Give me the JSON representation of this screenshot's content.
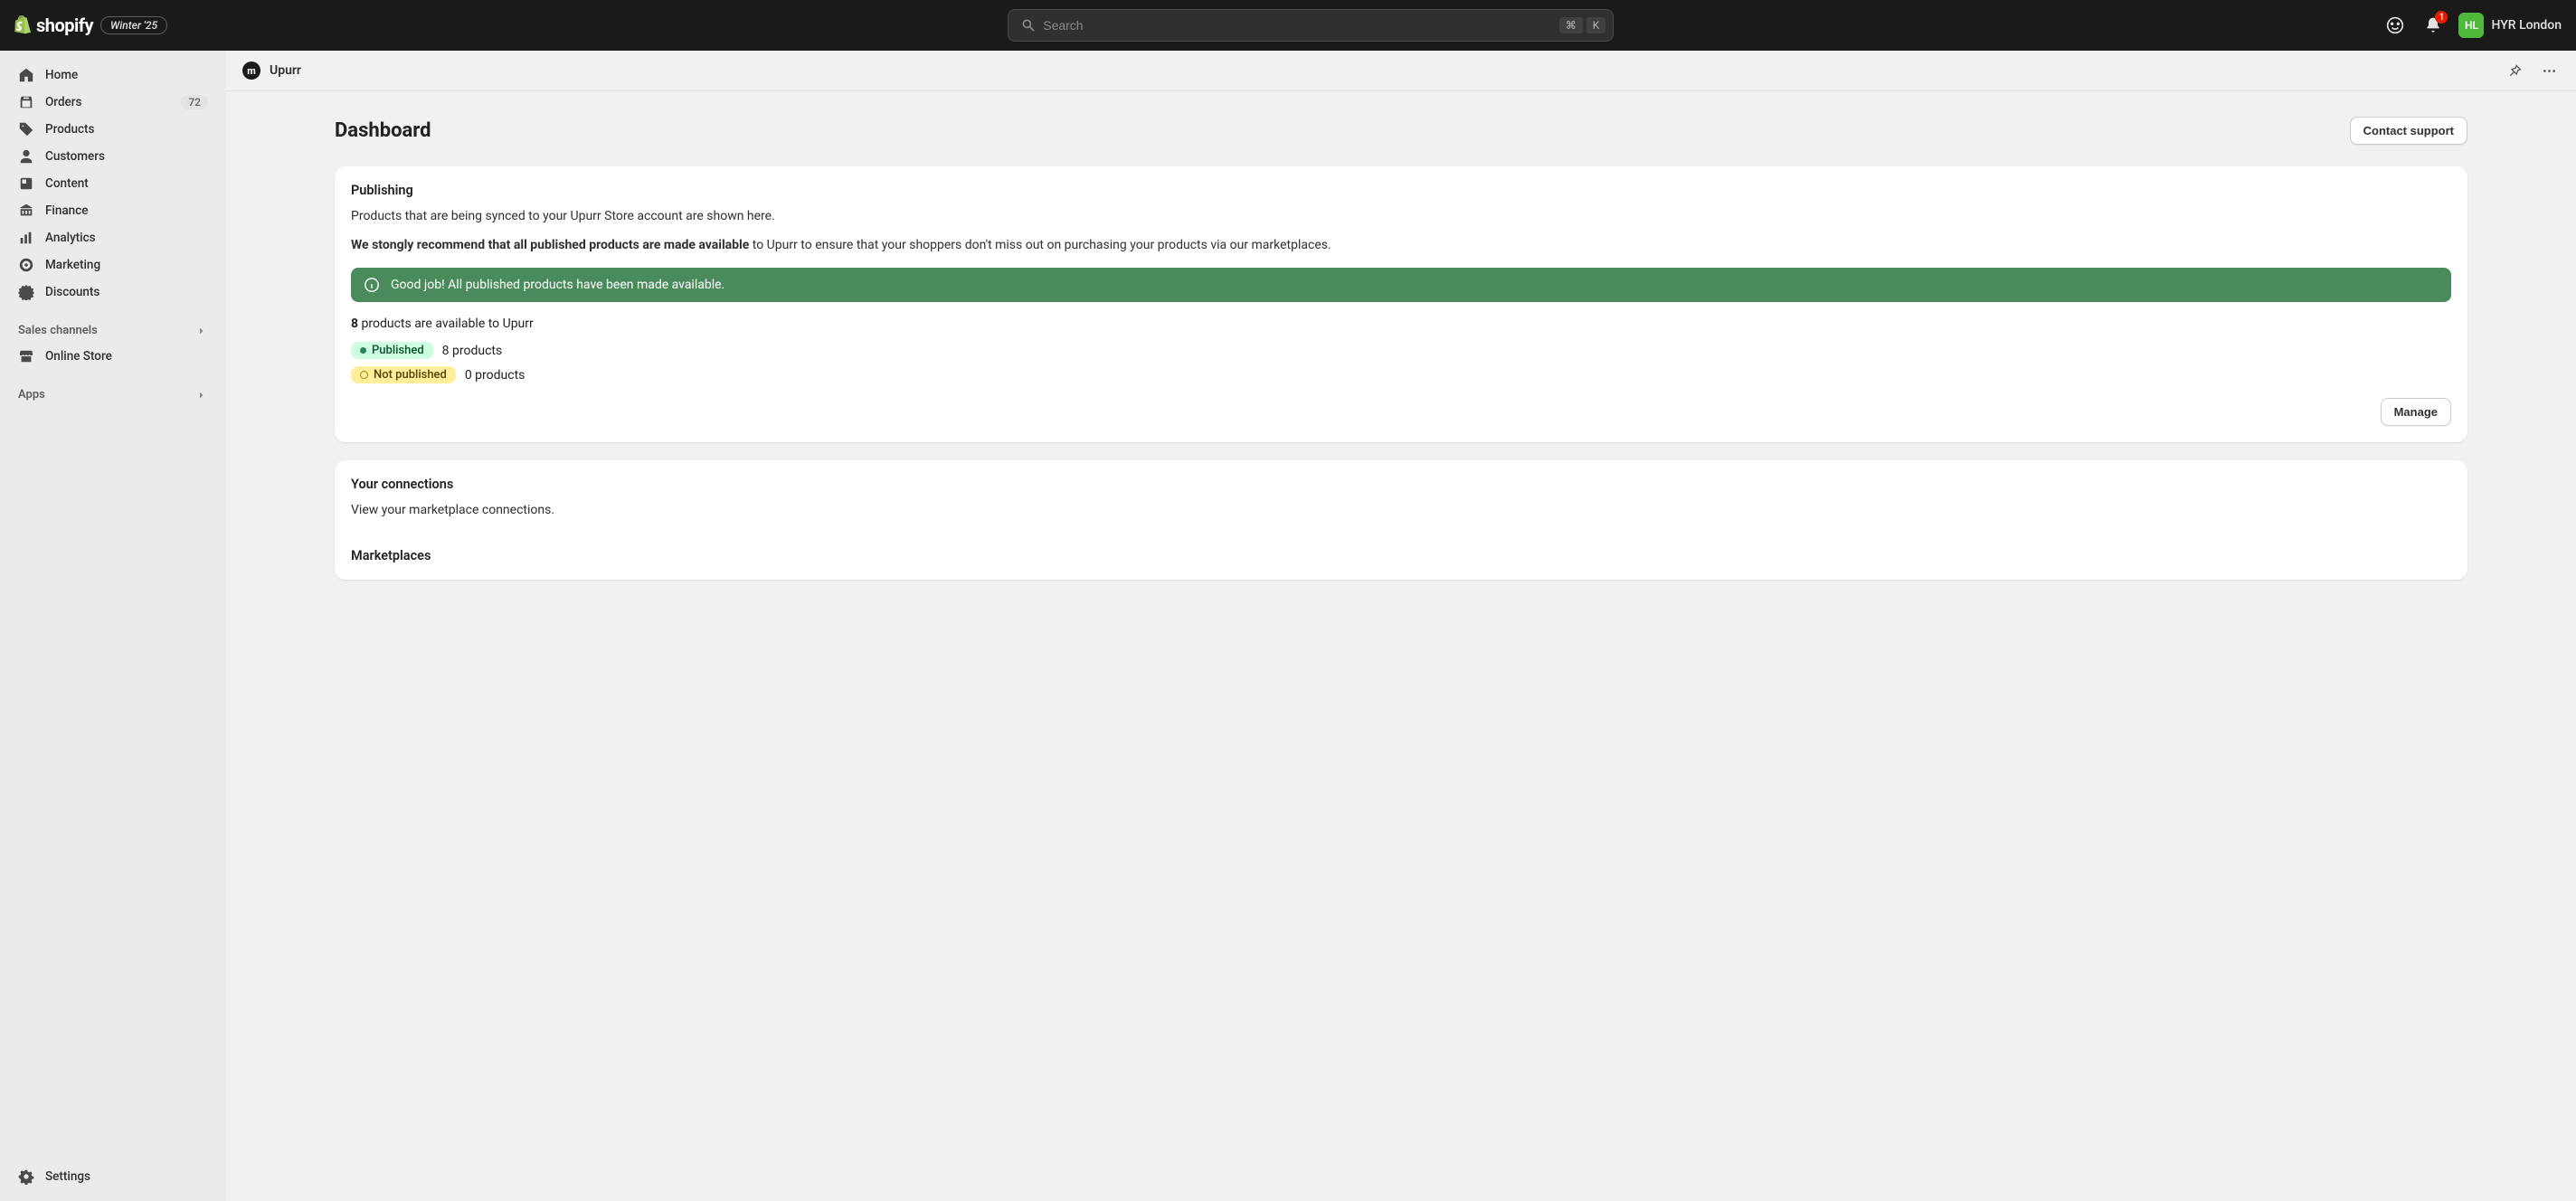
{
  "header": {
    "brand": "shopify",
    "edition_badge": "Winter '25",
    "search_placeholder": "Search",
    "shortcut_keys": [
      "⌘",
      "K"
    ],
    "notification_count": "1",
    "avatar_initials": "HL",
    "user_name": "HYR London"
  },
  "sidebar": {
    "items": [
      {
        "label": "Home",
        "icon": "home"
      },
      {
        "label": "Orders",
        "icon": "orders",
        "badge": "72"
      },
      {
        "label": "Products",
        "icon": "products"
      },
      {
        "label": "Customers",
        "icon": "customers"
      },
      {
        "label": "Content",
        "icon": "content"
      },
      {
        "label": "Finance",
        "icon": "finance"
      },
      {
        "label": "Analytics",
        "icon": "analytics"
      },
      {
        "label": "Marketing",
        "icon": "marketing"
      },
      {
        "label": "Discounts",
        "icon": "discounts"
      }
    ],
    "section_sales": "Sales channels",
    "online_store": "Online Store",
    "section_apps": "Apps",
    "settings": "Settings"
  },
  "app_bar": {
    "app_icon_letter": "m",
    "title": "Upurr"
  },
  "page": {
    "title": "Dashboard",
    "contact_btn": "Contact support"
  },
  "publishing": {
    "title": "Publishing",
    "description": "Products that are being synced to your Upurr Store account are shown here.",
    "recommend_bold": "We stongly recommend that all published products are made available",
    "recommend_rest": " to Upurr to ensure that your shoppers don't miss out on purchasing your products via our marketplaces.",
    "banner_text": "Good job! All published products have been made available.",
    "available_count": "8",
    "available_text": " products are available to Upurr",
    "published_badge": "Published",
    "published_count": "8 products",
    "not_published_badge": "Not published",
    "not_published_count": "0 products",
    "manage_btn": "Manage"
  },
  "connections": {
    "title": "Your connections",
    "description": "View your marketplace connections.",
    "marketplaces_title": "Marketplaces"
  }
}
